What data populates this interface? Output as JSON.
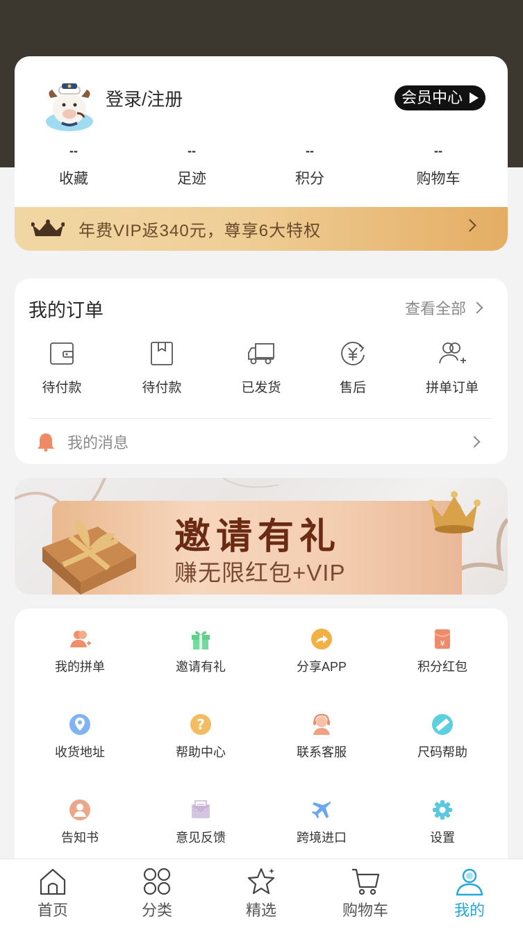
{
  "profile": {
    "login_label": "登录/注册",
    "member_center_label": "会员中心",
    "stats": [
      {
        "value": "--",
        "label": "收藏"
      },
      {
        "value": "--",
        "label": "足迹"
      },
      {
        "value": "--",
        "label": "积分"
      },
      {
        "value": "--",
        "label": "购物车"
      }
    ],
    "vip_banner_text": "年费VIP返340元，尊享6大特权"
  },
  "orders": {
    "title": "我的订单",
    "view_all_label": "查看全部",
    "items": [
      {
        "label": "待付款",
        "icon": "wallet-icon"
      },
      {
        "label": "待付款",
        "icon": "package-icon"
      },
      {
        "label": "已发货",
        "icon": "truck-icon"
      },
      {
        "label": "售后",
        "icon": "yuan-refund-icon"
      },
      {
        "label": "拼单订单",
        "icon": "group-add-icon"
      }
    ],
    "messages_label": "我的消息"
  },
  "promo_banner": {
    "title": "邀请有礼",
    "subtitle": "赚无限红包+VIP"
  },
  "services": [
    {
      "label": "我的拼单",
      "icon": "group-order-icon",
      "color": "#f0906a"
    },
    {
      "label": "邀请有礼",
      "icon": "gift-icon",
      "color": "#5fd08a"
    },
    {
      "label": "分享APP",
      "icon": "share-icon",
      "color": "#f2b145"
    },
    {
      "label": "积分红包",
      "icon": "red-envelope-icon",
      "color": "#ef8a6a"
    },
    {
      "label": "收货地址",
      "icon": "location-pin-icon",
      "color": "#6ba7f0"
    },
    {
      "label": "帮助中心",
      "icon": "question-icon",
      "color": "#f2b955"
    },
    {
      "label": "联系客服",
      "icon": "customer-service-icon",
      "color": "#f0a184"
    },
    {
      "label": "尺码帮助",
      "icon": "ruler-icon",
      "color": "#5cd0e0"
    },
    {
      "label": "告知书",
      "icon": "user-notice-icon",
      "color": "#eca78a"
    },
    {
      "label": "意见反馈",
      "icon": "feedback-mail-icon",
      "color": "#c8b4d8"
    },
    {
      "label": "跨境进口",
      "icon": "airplane-icon",
      "color": "#6ba7f0"
    },
    {
      "label": "设置",
      "icon": "gear-icon",
      "color": "#5cc7e0"
    }
  ],
  "tabbar": {
    "items": [
      {
        "label": "首页",
        "icon": "home-icon"
      },
      {
        "label": "分类",
        "icon": "category-icon"
      },
      {
        "label": "精选",
        "icon": "star-icon"
      },
      {
        "label": "购物车",
        "icon": "cart-icon"
      },
      {
        "label": "我的",
        "icon": "profile-icon"
      }
    ],
    "active_color": "#25a7d9"
  }
}
